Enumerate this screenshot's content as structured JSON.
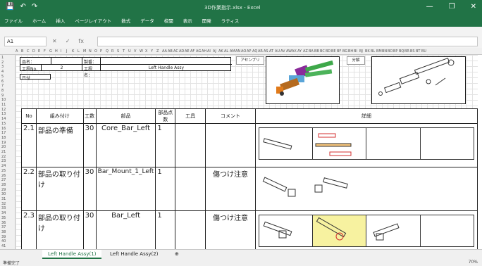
{
  "titlebar": {
    "qat_save": "💾",
    "qat_undo": "↶",
    "qat_redo": "↷",
    "doc_title": "3D作業指示.xlsx - Excel",
    "minimize": "—",
    "restore": "❐",
    "close": "✕"
  },
  "ribbon_tabs": [
    "ファイル",
    "ホーム",
    "挿入",
    "ページレイアウト",
    "数式",
    "データ",
    "校閲",
    "表示",
    "開発",
    "ラティス"
  ],
  "formula_bar": {
    "name_box": "A1",
    "fx": "fx",
    "value": ""
  },
  "col_headers": [
    "A",
    "B",
    "C",
    "D",
    "E",
    "F",
    "G",
    "H",
    "I",
    "J",
    "K",
    "L",
    "M",
    "N",
    "O",
    "P",
    "Q",
    "R",
    "S",
    "T",
    "U",
    "V",
    "W",
    "X",
    "Y",
    "Z",
    "AA",
    "AB",
    "AC",
    "AD",
    "AE",
    "AF",
    "AG",
    "AH",
    "AI",
    "AJ",
    "AK",
    "AL",
    "AM",
    "AN",
    "AO",
    "AP",
    "AQ",
    "AR",
    "AS",
    "AT",
    "AU",
    "AV",
    "AW",
    "AX",
    "AY",
    "AZ",
    "BA",
    "BB",
    "BC",
    "BD",
    "BE",
    "BF",
    "BG",
    "BH",
    "BI",
    "BJ",
    "BK",
    "BL",
    "BM",
    "BN",
    "BO",
    "BP",
    "BQ",
    "BR",
    "BS",
    "BT",
    "BU"
  ],
  "row_headers": [
    "1",
    "2",
    "3",
    "4",
    "5",
    "6",
    "7",
    "8",
    "9",
    "10",
    "11",
    "12",
    "13",
    "14",
    "15",
    "16",
    "17",
    "18",
    "19",
    "20",
    "21",
    "22",
    "23",
    "24",
    "25",
    "26",
    "27",
    "28",
    "29",
    "30",
    "31",
    "32",
    "33",
    "34",
    "35",
    "36",
    "37",
    "38",
    "39",
    "40",
    "41"
  ],
  "header_info": {
    "part_name_label": "品名：",
    "work_no_label": "工程No.",
    "work_no": "2",
    "setup_label": "製番：",
    "process_label": "工程名：",
    "process_name": "Left Handle Assy",
    "date_label": "日付"
  },
  "buttons": {
    "assembly": "アセンブリ",
    "disassembly": "分解"
  },
  "table": {
    "headers": [
      "No",
      "組み付け",
      "工数",
      "部品",
      "部品点数",
      "工具",
      "コメント",
      "詳細"
    ],
    "rows": [
      {
        "no": "2.1",
        "task": "部品の準備",
        "time": "30",
        "part": "Core_Bar_Left",
        "qty": "1",
        "tool": "",
        "comment": ""
      },
      {
        "no": "2.2",
        "task": "部品の取り付け",
        "time": "30",
        "part": "Bar_Mount_1_Left",
        "qty": "1",
        "tool": "",
        "comment": "傷つけ注意"
      },
      {
        "no": "2.3",
        "task": "部品の取り付け",
        "time": "30",
        "part": "Bar_Left",
        "qty": "1",
        "tool": "",
        "comment": "傷つけ注意"
      }
    ]
  },
  "sheet_tabs": [
    "Left Handle Assy(1)",
    "Left Handle Assy(2)"
  ],
  "add_sheet": "⊕",
  "status": {
    "ready": "準備完了",
    "zoom": "70%"
  },
  "colors": {
    "excel_green": "#217346",
    "annotation_red": "#d32f2f",
    "highlight_yellow": "#f7f2a0"
  }
}
